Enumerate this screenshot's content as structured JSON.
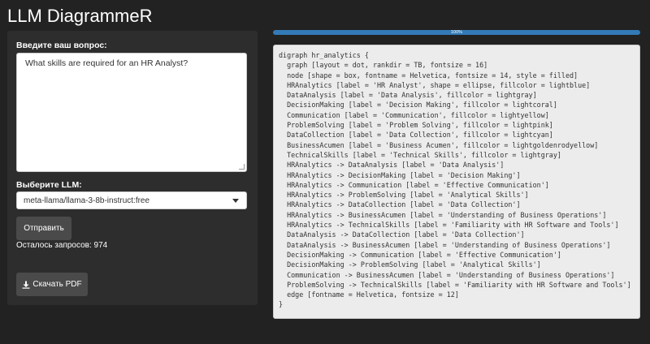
{
  "app": {
    "title": "LLM DiagrammeR"
  },
  "sidebar": {
    "question_label": "Введите ваш вопрос:",
    "question_value": "What skills are required for an HR Analyst?",
    "llm_label": "Выберите LLM:",
    "llm_selected": "meta-llama/llama-3-8b-instruct:free",
    "send_button": "Отправить",
    "remaining_text": "Осталось запросов: 974",
    "pdf_button": "Скачать PDF"
  },
  "progress": {
    "value": 1.0,
    "label": "100%"
  },
  "code": {
    "lines": [
      "digraph hr_analytics {",
      "  graph [layout = dot, rankdir = TB, fontsize = 16]",
      "  node [shape = box, fontname = Helvetica, fontsize = 14, style = filled]",
      "  HRAnalytics [label = 'HR Analyst', shape = ellipse, fillcolor = lightblue]",
      "  DataAnalysis [label = 'Data Analysis', fillcolor = lightgray]",
      "  DecisionMaking [label = 'Decision Making', fillcolor = lightcoral]",
      "  Communication [label = 'Communication', fillcolor = lightyellow]",
      "  ProblemSolving [label = 'Problem Solving', fillcolor = lightpink]",
      "  DataCollection [label = 'Data Collection', fillcolor = lightcyan]",
      "  BusinessAcumen [label = 'Business Acumen', fillcolor = lightgoldenrodyellow]",
      "  TechnicalSkills [label = 'Technical Skills', fillcolor = lightgray]",
      "  HRAnalytics -> DataAnalysis [label = 'Data Analysis']",
      "  HRAnalytics -> DecisionMaking [label = 'Decision Making']",
      "  HRAnalytics -> Communication [label = 'Effective Communication']",
      "  HRAnalytics -> ProblemSolving [label = 'Analytical Skills']",
      "  HRAnalytics -> DataCollection [label = 'Data Collection']",
      "  HRAnalytics -> BusinessAcumen [label = 'Understanding of Business Operations']",
      "  HRAnalytics -> TechnicalSkills [label = 'Familiarity with HR Software and Tools']",
      "  DataAnalysis -> DataCollection [label = 'Data Collection']",
      "  DataAnalysis -> BusinessAcumen [label = 'Understanding of Business Operations']",
      "  DecisionMaking -> Communication [label = 'Effective Communication']",
      "  DecisionMaking -> ProblemSolving [label = 'Analytical Skills']",
      "  Communication -> BusinessAcumen [label = 'Understanding of Business Operations']",
      "  ProblemSolving -> TechnicalSkills [label = 'Familiarity with HR Software and Tools']",
      "  edge [fontname = Helvetica, fontsize = 12]",
      "}"
    ]
  },
  "colors": {
    "background": "#222222",
    "panel": "#2d2d2d",
    "progress_fill": "#337ab7",
    "button": "#4a4a4a",
    "code_bg": "#ececec"
  },
  "icons": {
    "pdf_button_icon": "download-icon",
    "select_icon": "caret-down-icon"
  }
}
